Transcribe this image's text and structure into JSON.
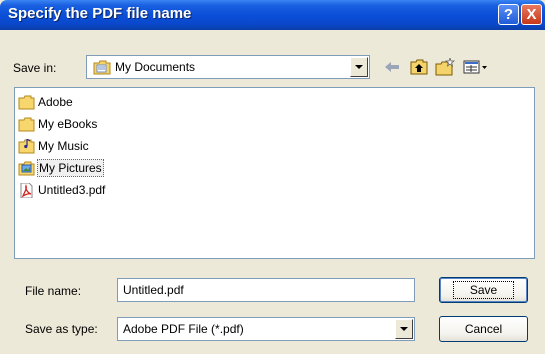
{
  "window": {
    "title": "Specify the PDF file name",
    "help_glyph": "?",
    "close_glyph": "X"
  },
  "save_in": {
    "label": "Save in:",
    "value": "My Documents",
    "icons": [
      "up-one-level-back-icon",
      "up-folder-icon",
      "new-folder-icon",
      "view-menu-icon"
    ]
  },
  "files": [
    {
      "name": "Adobe",
      "icon": "folder-icon"
    },
    {
      "name": "My eBooks",
      "icon": "folder-icon"
    },
    {
      "name": "My Music",
      "icon": "music-folder-icon"
    },
    {
      "name": "My Pictures",
      "icon": "pictures-folder-icon",
      "selected": true
    },
    {
      "name": "Untitled3.pdf",
      "icon": "pdf-file-icon"
    }
  ],
  "file_name": {
    "label": "File name:",
    "value": "Untitled.pdf"
  },
  "save_as_type": {
    "label": "Save as type:",
    "value": "Adobe PDF File (*.pdf)"
  },
  "buttons": {
    "save": "Save",
    "cancel": "Cancel"
  }
}
